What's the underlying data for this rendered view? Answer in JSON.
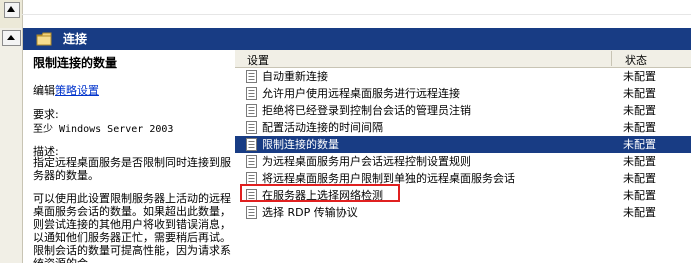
{
  "header": {
    "title": "连接"
  },
  "left_panel": {
    "policy_title": "限制连接的数量",
    "edit_prefix": "编辑",
    "edit_link": "策略设置",
    "requirements_label": "要求:",
    "requirements_value": "至少 Windows Server 2003",
    "description_label": "描述:",
    "description_p1": "指定远程桌面服务是否限制同时连接到服务器的数量。",
    "description_p2": "可以使用此设置限制服务器上活动的远程桌面服务会话的数量。如果超出此数量，则尝试连接的其他用户将收到错误消息，以通知他们服务器正忙，需要稍后再试。限制会话的数量可提高性能，因为请求系统资源的会"
  },
  "table": {
    "columns": [
      "设置",
      "状态"
    ],
    "rows": [
      {
        "name": "自动重新连接",
        "state": "未配置",
        "selected": false
      },
      {
        "name": "允许用户使用远程桌面服务进行远程连接",
        "state": "未配置",
        "selected": false
      },
      {
        "name": "拒绝将已经登录到控制台会话的管理员注销",
        "state": "未配置",
        "selected": false
      },
      {
        "name": "配置活动连接的时间间隔",
        "state": "未配置",
        "selected": false
      },
      {
        "name": "限制连接的数量",
        "state": "未配置",
        "selected": true
      },
      {
        "name": "为远程桌面服务用户会话远程控制设置规则",
        "state": "未配置",
        "selected": false
      },
      {
        "name": "将远程桌面服务用户限制到单独的远程桌面服务会话",
        "state": "未配置",
        "selected": false
      },
      {
        "name": "在服务器上选择网络检测",
        "state": "未配置",
        "selected": false
      },
      {
        "name": "选择 RDP 传输协议",
        "state": "未配置",
        "selected": false
      }
    ]
  },
  "colors": {
    "header_bg": "#183c84",
    "selection_bg": "#183c84",
    "link": "#0033cc",
    "highlight_box": "#e02020"
  },
  "icons": {
    "header": "folder-icon",
    "row": "policy-setting-icon",
    "scroll": "scroll-up-arrow-icon"
  }
}
